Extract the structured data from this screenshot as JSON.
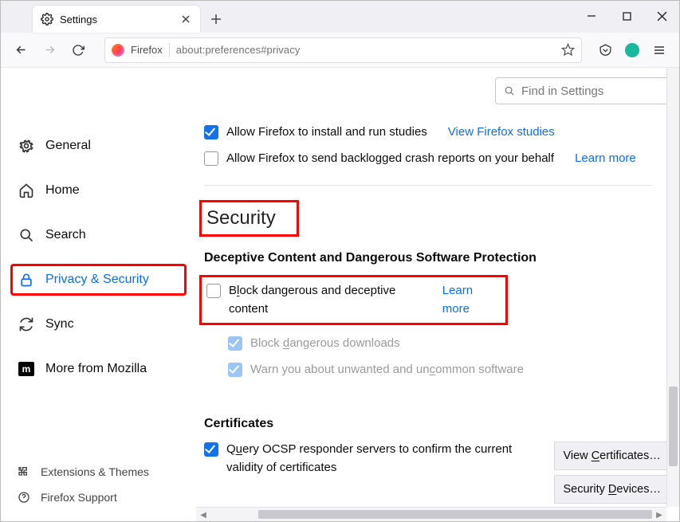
{
  "tab": {
    "title": "Settings"
  },
  "urlbar": {
    "identity": "Firefox",
    "url": "about:preferences#privacy"
  },
  "search": {
    "placeholder": "Find in Settings"
  },
  "nav": {
    "general": "General",
    "home": "Home",
    "search": "Search",
    "privacy": "Privacy & Security",
    "sync": "Sync",
    "more": "More from Mozilla"
  },
  "footer": {
    "extensions": "Extensions & Themes",
    "support": "Firefox Support"
  },
  "studies": {
    "allow": "Allow Firefox to install and run studies",
    "link": "View Firefox studies"
  },
  "crash": {
    "allow": "Allow Firefox to send backlogged crash reports on your behalf",
    "link": "Learn more"
  },
  "security": {
    "heading": "Security",
    "deceptive_h": "Deceptive Content and Dangerous Software Protection",
    "block_pre": "B",
    "block_und": "l",
    "block_post": "ock dangerous and deceptive content",
    "block_link": "Learn more",
    "downloads_pre": "Block ",
    "downloads_und": "d",
    "downloads_post": "angerous downloads",
    "warn_pre": "Warn you about unwanted and un",
    "warn_und": "c",
    "warn_post": "ommon software"
  },
  "certs": {
    "heading": "Certificates",
    "ocsp_pre": "Q",
    "ocsp_und": "u",
    "ocsp_post": "ery OCSP responder servers to confirm the current validity of certificates",
    "view_pre": "View ",
    "view_und": "C",
    "view_post": "ertificates…",
    "devices_pre": "Security ",
    "devices_und": "D",
    "devices_post": "evices…"
  }
}
